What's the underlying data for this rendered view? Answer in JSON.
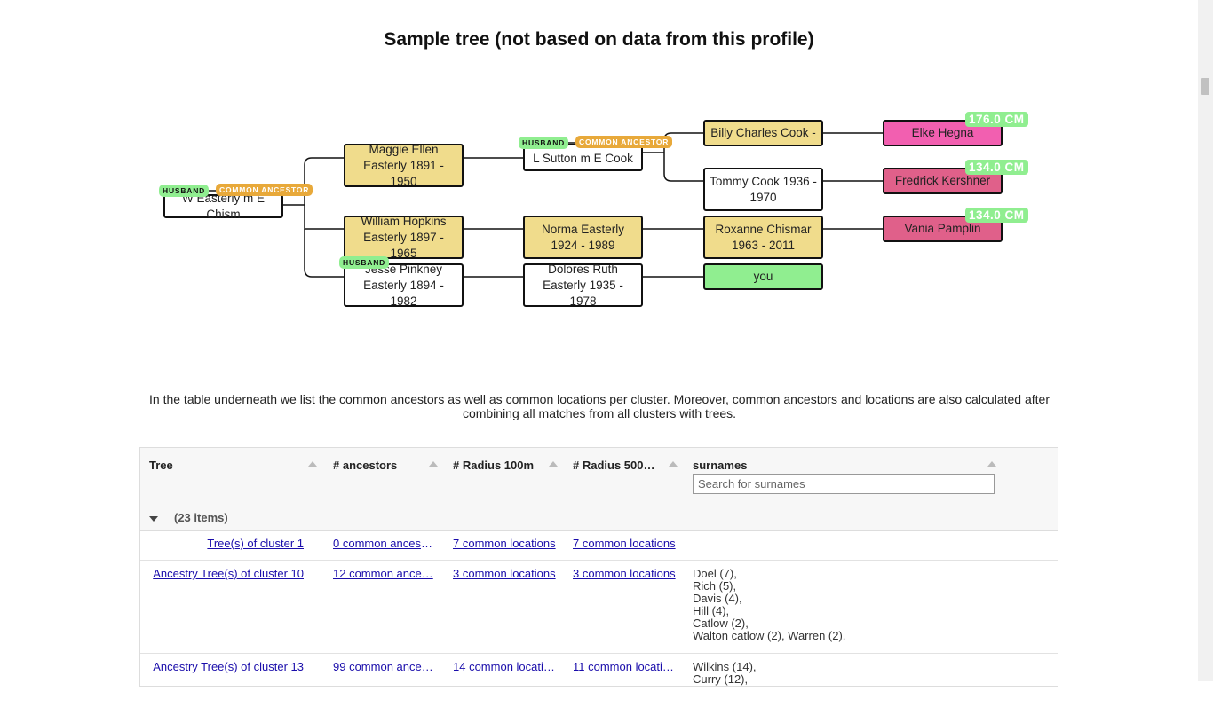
{
  "title": "Sample tree (not based on data from this profile)",
  "tree": {
    "root": {
      "name": "W Easterly m E Chism",
      "tag_husband": "HUSBAND",
      "tag_common": "COMMON ANCESTOR"
    },
    "gen1": [
      {
        "name": "Maggie Ellen Easterly 1891 - 1950"
      },
      {
        "name": "William Hopkins Easterly 1897 - 1965"
      },
      {
        "name": "Jesse Pinkney Easterly 1894 - 1982",
        "tag_husband": "HUSBAND"
      }
    ],
    "gen2": [
      {
        "name": "L Sutton m E Cook",
        "tag_husband": "HUSBAND",
        "tag_common": "COMMON ANCESTOR"
      },
      {
        "name": "Norma Easterly 1924 - 1989"
      },
      {
        "name": "Dolores Ruth Easterly 1935 - 1978"
      }
    ],
    "gen3": [
      {
        "name": "Billy Charles Cook -"
      },
      {
        "name": "Tommy Cook 1936 - 1970"
      },
      {
        "name": "Roxanne Chismar 1963 - 2011"
      },
      {
        "name": "you"
      }
    ],
    "matches": [
      {
        "name": "Elke Hegna",
        "cm": "176.0 CM"
      },
      {
        "name": "Fredrick Kershner",
        "cm": "134.0 CM"
      },
      {
        "name": "Vania Pamplin",
        "cm": "134.0 CM"
      }
    ]
  },
  "intro": "In the table underneath we list the common ancestors as well as common locations per cluster. Moreover, common ancestors and locations are also calculated after combining all matches from all clusters with trees.",
  "grid": {
    "columns": [
      "Tree",
      "# ancestors",
      "# Radius 100m",
      "# Radius 500…",
      "surnames"
    ],
    "search_placeholder": "Search for surnames",
    "group_label": "(23 items)",
    "rows": [
      {
        "tree": "Tree(s) of cluster 1",
        "ancestors": "0 common ancest…",
        "r100": "7 common locations",
        "r500": "7 common locations",
        "surnames": []
      },
      {
        "tree": "Ancestry Tree(s) of cluster 10",
        "ancestors": "12 common ance…",
        "r100": "3 common locations",
        "r500": "3 common locations",
        "surnames": [
          "Doel (7),",
          "Rich (5),",
          "Davis (4),",
          "Hill (4),",
          "Catlow (2),",
          "Walton catlow (2), Warren (2),"
        ]
      },
      {
        "tree": "Ancestry Tree(s) of cluster 13",
        "ancestors": "99 common ance…",
        "r100": "14 common locati…",
        "r500": "11 common locati…",
        "surnames": [
          "Wilkins (14),",
          "Curry (12),"
        ]
      }
    ]
  },
  "colors": {
    "ancestor": "#f0dc8c",
    "you": "#90ee90",
    "match_pink": "#f25fb0",
    "match_rose": "#e0608a",
    "common_tag": "#e8a93a",
    "link": "#1a0dab"
  }
}
